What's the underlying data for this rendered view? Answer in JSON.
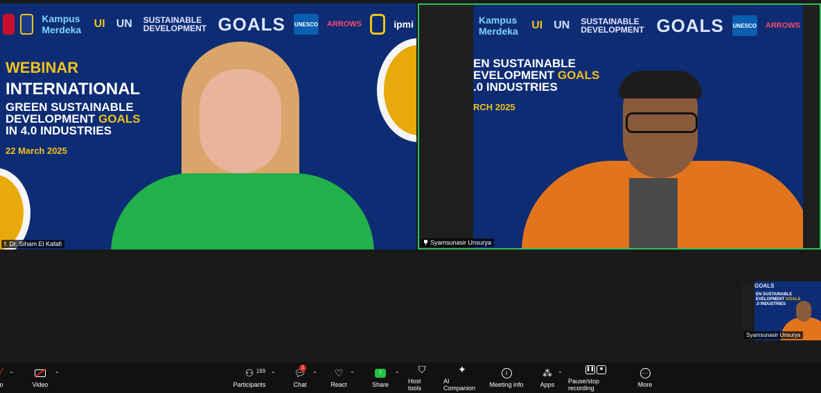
{
  "banner": {
    "logos": {
      "kampus": "Kampus Merdeka",
      "uin": "UI",
      "un": "UN",
      "sdg": "SUSTAINABLE DEVELOPMENT",
      "goals": "GOALS",
      "unesco": "UNESCO",
      "arrows": "ARROWS",
      "ipmi": "ipmi"
    },
    "webinar": "WEBINAR",
    "international": "INTERNATIONAL",
    "line_green": "GREEN SUSTAINABLE",
    "line_dev_a": "DEVELOPMENT ",
    "line_dev_b": "GOALS",
    "line_ind": "IN 4.0 INDUSTRIES",
    "date": "22 March 2025"
  },
  "banner_right": {
    "line_green": "EN SUSTAINABLE",
    "line_dev_a": "EVELOPMENT ",
    "line_dev_b": "GOALS",
    "line_ind": ".0 INDUSTRIES",
    "date": "RCH 2025"
  },
  "participants": {
    "left_name": "f. Dr. Siham El Kafafi",
    "right_name": "Syamsunasir Unsurya",
    "self_name": "Syamsunasir Unsurya"
  },
  "selfview": {
    "logos": "GOALS",
    "line1": "EN SUSTAINABLE",
    "line2a": "EVELOPMENT ",
    "line2b": "GOALS",
    "line3": ".0 INDUSTRIES"
  },
  "toolbar": {
    "audio": "io",
    "video": "Video",
    "participants": "Participants",
    "participants_count": "199",
    "chat": "Chat",
    "chat_badge": "1",
    "react": "React",
    "share": "Share",
    "host_tools": "Host tools",
    "ai_companion": "AI Companion",
    "meeting_info": "Meeting info",
    "apps": "Apps",
    "recording": "Pause/stop recording",
    "more": "More"
  },
  "colors": {
    "banner_blue": "#0d2c74",
    "accent_yellow": "#f2c21b",
    "active_border": "#2fc05a",
    "share_green": "#23c043",
    "badge_red": "#e02a2a"
  },
  "icons": [
    "participants-icon",
    "chat-icon",
    "react-icon",
    "share-icon",
    "shield-icon",
    "sparkle-icon",
    "info-icon",
    "apps-icon",
    "record-icon",
    "more-icon",
    "video-off-icon",
    "pin-icon"
  ]
}
